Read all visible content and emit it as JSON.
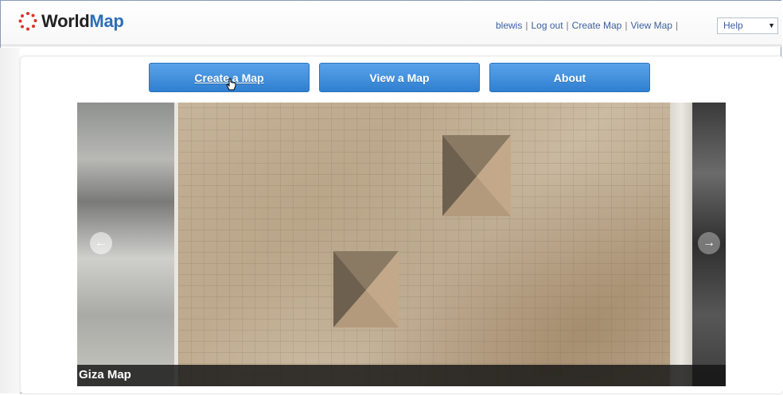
{
  "app": {
    "logo_part1": "World",
    "logo_part2": "Map"
  },
  "top_nav": {
    "user": "blewis",
    "logout": "Log out",
    "create_map": "Create Map",
    "view_map": "View Map",
    "separator": "|",
    "help_select": "Help"
  },
  "buttons": {
    "create": "Create a Map",
    "view": "View a Map",
    "about": "About"
  },
  "slideshow": {
    "caption": "Giza Map",
    "prev_icon": "arrow-left-icon",
    "next_icon": "arrow-right-icon"
  },
  "colors": {
    "brand_blue": "#2d6eb6",
    "button_blue": "#2f7fd0",
    "logo_red": "#e0302a"
  }
}
